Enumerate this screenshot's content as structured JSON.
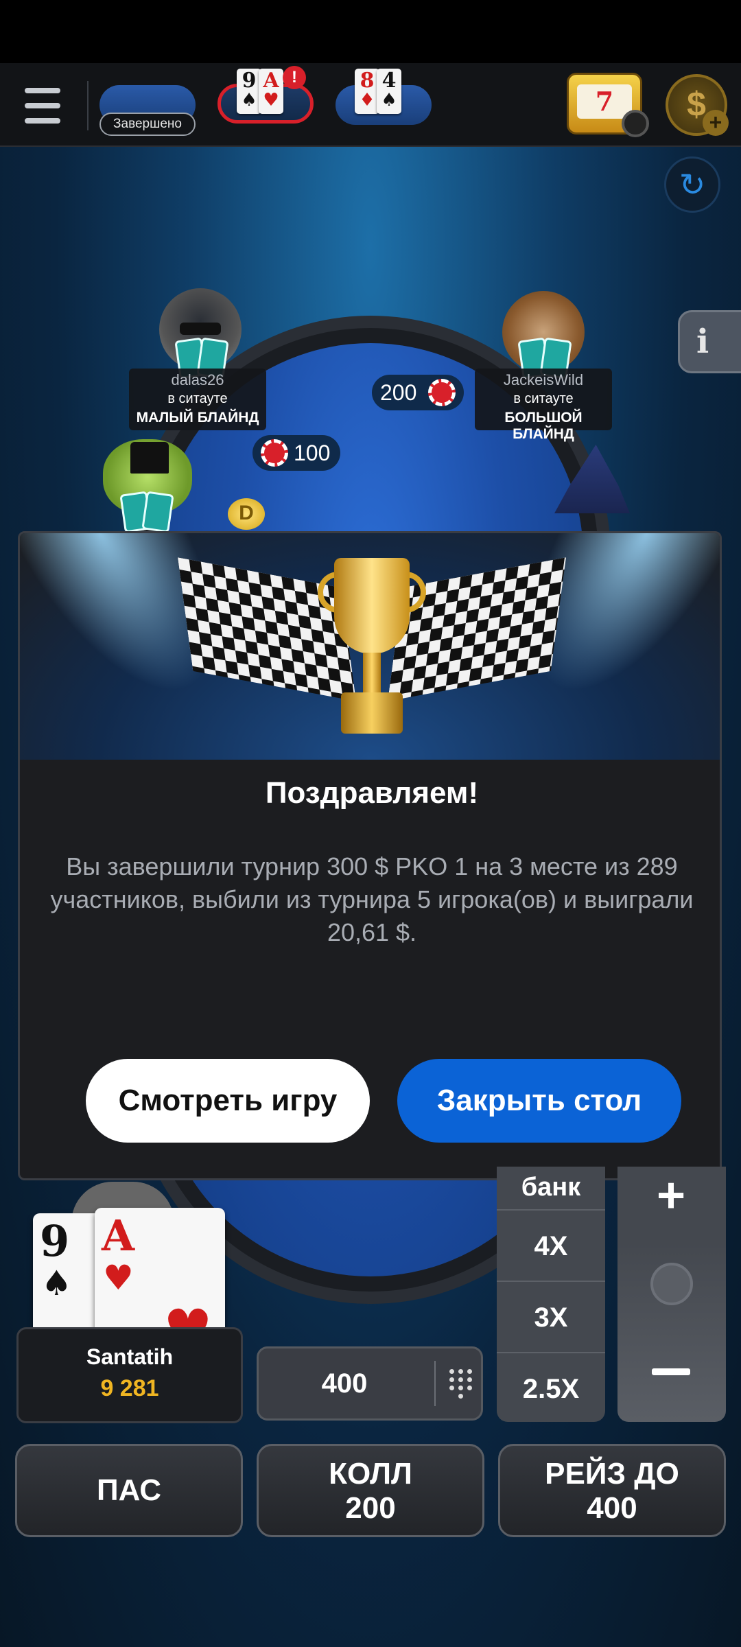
{
  "topbar": {
    "finished_label": "Завершено",
    "tables": [
      {
        "cards": [
          {
            "rank": "9",
            "suit": "♠",
            "color": "black"
          },
          {
            "rank": "A",
            "suit": "♥",
            "color": "red"
          }
        ],
        "alert": "!"
      },
      {
        "cards": [
          {
            "rank": "8",
            "suit": "♦",
            "color": "red"
          },
          {
            "rank": "4",
            "suit": "♠",
            "color": "black"
          }
        ]
      }
    ],
    "slot_icon": "slot-machine-icon",
    "slot_text": "7",
    "cash_icon": "dollar-chip-icon",
    "cash_symbol": "$",
    "cash_plus": "+"
  },
  "table": {
    "history_icon": "↻",
    "info_icon": "i",
    "players": [
      {
        "name": "dalas26",
        "status": "в ситауте",
        "role": "МАЛЫЙ БЛАЙНД"
      },
      {
        "name": "JackeisWild",
        "status": "в ситауте",
        "role": "БОЛЬШОЙ БЛАЙНД"
      }
    ],
    "bets": [
      "200",
      "100"
    ],
    "dealer": "D"
  },
  "modal": {
    "title": "Поздравляем!",
    "text": "Вы завершили турнир 300 $ PKO 1 на 3 месте из 289 участников, выбили из турнира 5 игрока(ов) и выиграли 20,61 $.",
    "watch_button": "Смотреть игру",
    "close_button": "Закрыть стол"
  },
  "hero": {
    "cards": [
      {
        "rank": "9",
        "suit": "♠"
      },
      {
        "rank": "A",
        "suit": "♥"
      }
    ],
    "name": "Santatih",
    "stack": "9 281"
  },
  "bet_controls": {
    "amount": "400",
    "quick": [
      "банк",
      "4X",
      "3X",
      "2.5X"
    ]
  },
  "actions": {
    "fold": "ПАС",
    "call": "КОЛЛ",
    "call_amount": "200",
    "raise": "РЕЙЗ ДО",
    "raise_amount": "400"
  },
  "colors": {
    "accent_blue": "#0b63d6",
    "stack_gold": "#f0b522",
    "alert_red": "#d8202a"
  }
}
